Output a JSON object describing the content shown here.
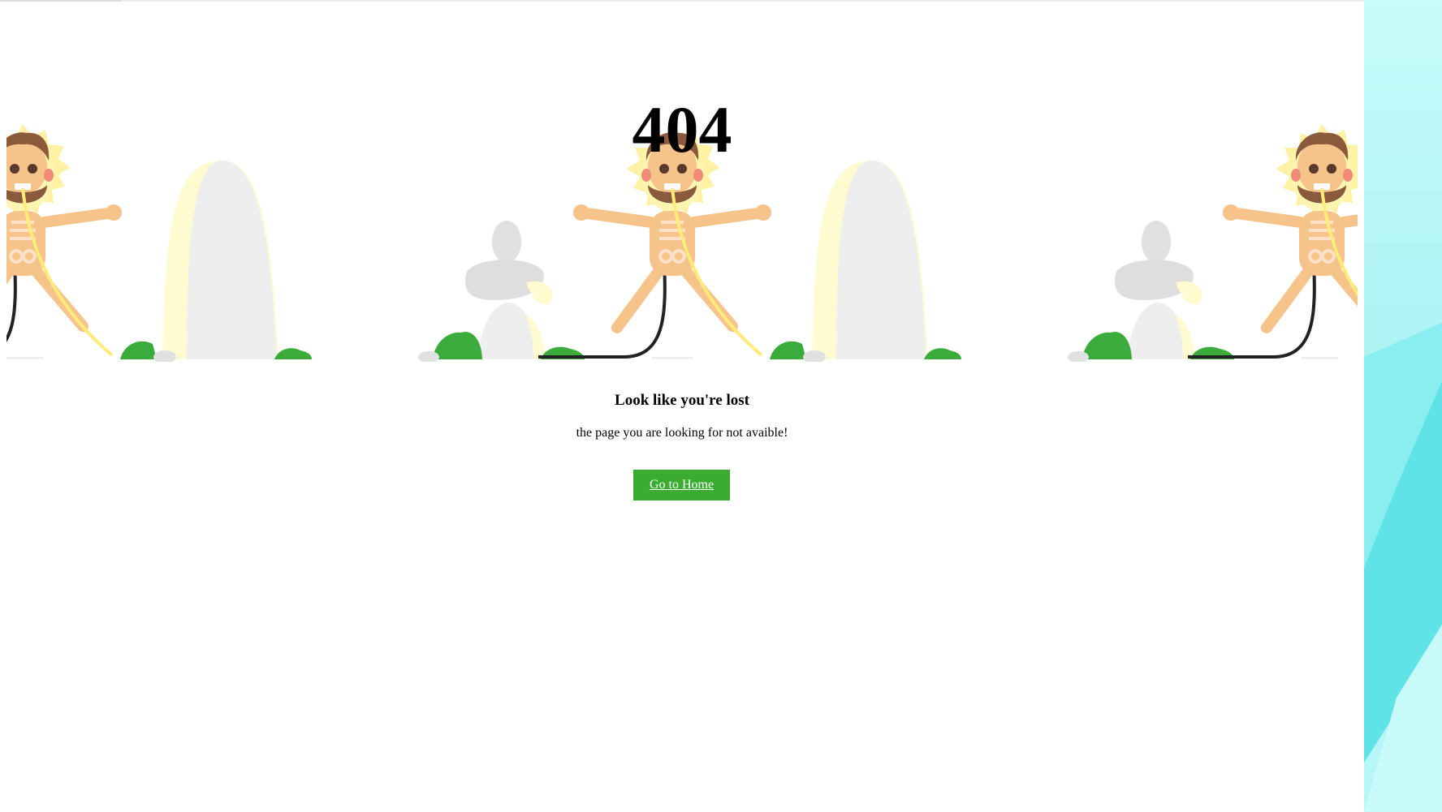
{
  "error": {
    "code": "404",
    "heading": "Look like you're lost",
    "message": "the page you are looking for not avaible!",
    "button_label": "Go to Home"
  },
  "colors": {
    "button_bg": "#39ac31",
    "button_text": "#ffffff",
    "desktop_bg": "#b6f7f8"
  },
  "illustration": {
    "icon": "electrocuted-skeleton-caveman-icon",
    "repeat_count": 3
  }
}
